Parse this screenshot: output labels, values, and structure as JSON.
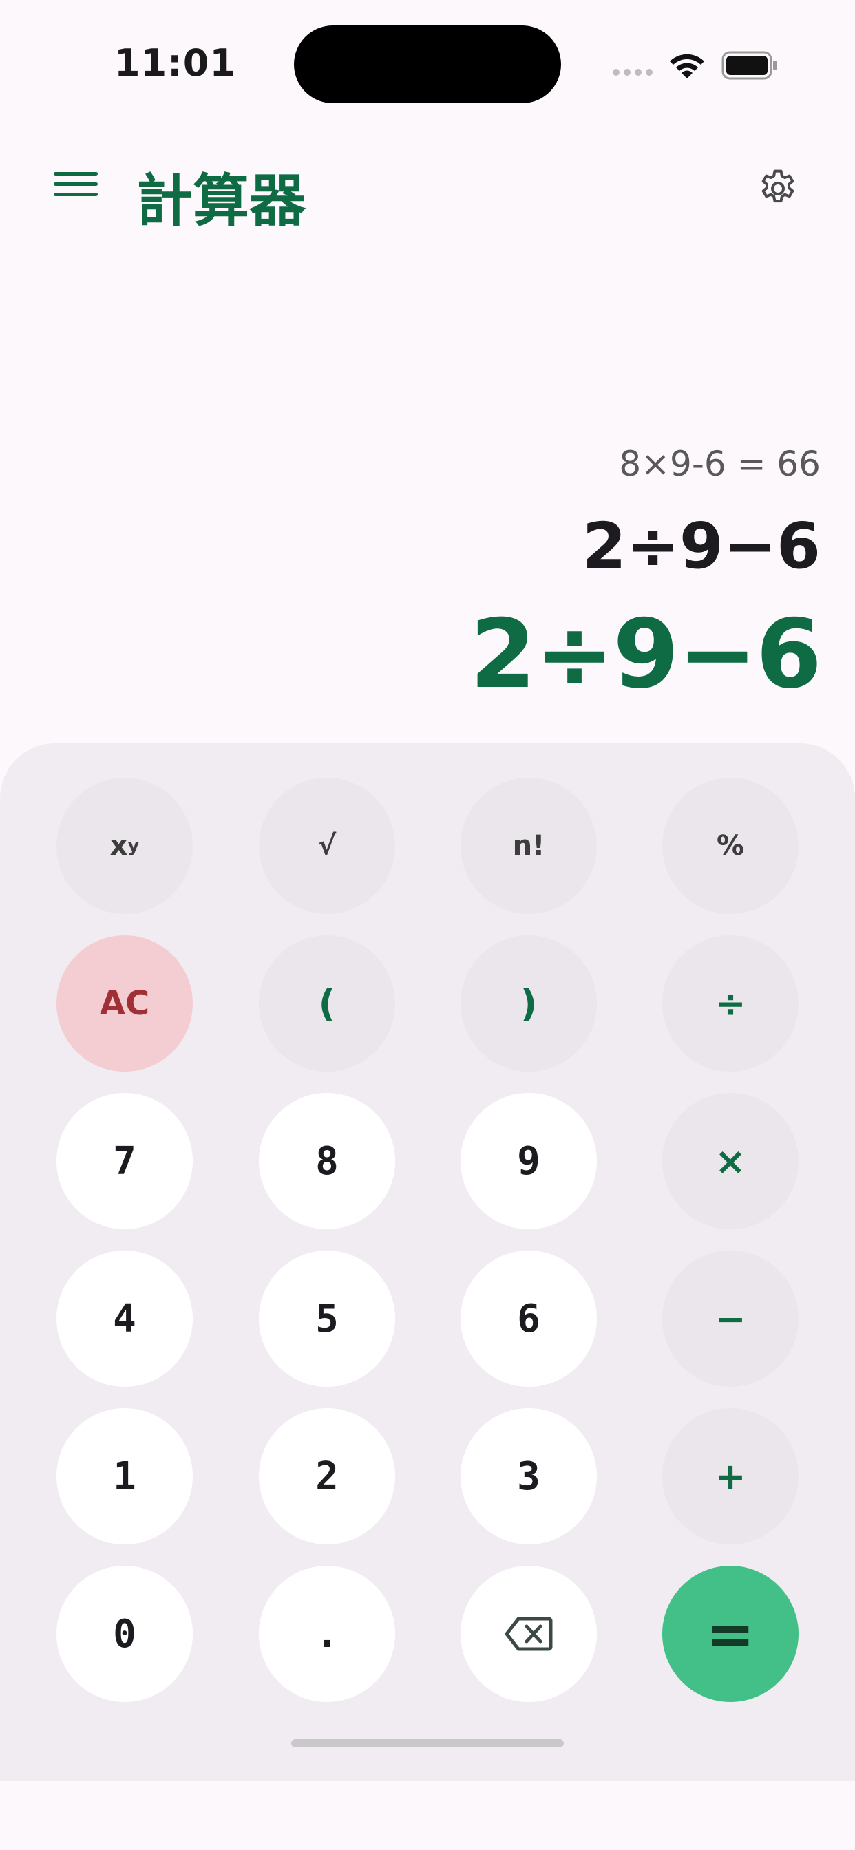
{
  "status_bar": {
    "time": "11:01"
  },
  "header": {
    "title": "計算器"
  },
  "display": {
    "history": "8×9-6 = 66",
    "expression": "2÷9−6",
    "result": "2÷9−6"
  },
  "keys": {
    "power_base": "x",
    "power_exp": "y",
    "sqrt": "√",
    "factorial": "n!",
    "percent": "%",
    "clear": "AC",
    "open_paren": "(",
    "close_paren": ")",
    "divide": "÷",
    "seven": "7",
    "eight": "8",
    "nine": "9",
    "multiply": "×",
    "four": "4",
    "five": "5",
    "six": "6",
    "minus": "−",
    "one": "1",
    "two": "2",
    "three": "3",
    "plus": "+",
    "zero": "0",
    "decimal": ".",
    "equals": "="
  },
  "colors": {
    "accent": "#0f6b44",
    "equals_bg": "#43c087",
    "clear_bg": "#f4cdd2",
    "clear_text": "#a12f36",
    "keypad_bg": "#f1ecf1"
  },
  "icons": [
    "menu-icon",
    "settings-icon",
    "backspace-icon",
    "wifi-icon",
    "battery-icon",
    "signal-icon"
  ]
}
